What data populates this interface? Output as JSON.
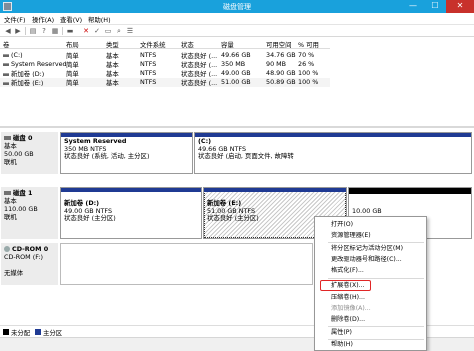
{
  "window": {
    "title": "磁盘管理",
    "min": "—",
    "max": "☐",
    "close": "✕"
  },
  "menubar": [
    "文件(F)",
    "操作(A)",
    "查看(V)",
    "帮助(H)"
  ],
  "toolbar_icons": [
    "back-icon",
    "forward-icon",
    "volume-list-icon",
    "help-icon",
    "properties-icon",
    "delete-icon",
    "cut-icon",
    "open-icon",
    "search-icon",
    "snapshot-icon"
  ],
  "volume_list": {
    "columns": [
      "卷",
      "布局",
      "类型",
      "文件系统",
      "状态",
      "容量",
      "可用空间",
      "% 可用"
    ],
    "rows": [
      {
        "name": "(C:)",
        "layout": "简单",
        "type": "基本",
        "fs": "NTFS",
        "status": "状态良好 (...",
        "capacity": "49.66 GB",
        "free": "34.76 GB",
        "pct": "70 %"
      },
      {
        "name": "System Reserved",
        "layout": "简单",
        "type": "基本",
        "fs": "NTFS",
        "status": "状态良好 (...",
        "capacity": "350 MB",
        "free": "90 MB",
        "pct": "26 %"
      },
      {
        "name": "新加卷 (D:)",
        "layout": "简单",
        "type": "基本",
        "fs": "NTFS",
        "status": "状态良好 (...",
        "capacity": "49.00 GB",
        "free": "48.90 GB",
        "pct": "100 %"
      },
      {
        "name": "新加卷 (E:)",
        "layout": "简单",
        "type": "基本",
        "fs": "NTFS",
        "status": "状态良好 (...",
        "capacity": "51.00 GB",
        "free": "50.89 GB",
        "pct": "100 %"
      }
    ]
  },
  "disks": [
    {
      "label": "磁盘 0",
      "type": "基本",
      "size": "50.00 GB",
      "state": "联机",
      "partitions": [
        {
          "name": "System Reserved",
          "detail": "350 MB NTFS",
          "status": "状态良好 (系统, 活动, 主分区)"
        },
        {
          "name": "(C:)",
          "detail": "49.66 GB NTFS",
          "status": "状态良好 (启动, 页面文件, 故障转"
        }
      ]
    },
    {
      "label": "磁盘 1",
      "type": "基本",
      "size": "110.00 GB",
      "state": "联机",
      "partitions": [
        {
          "name": "新加卷 (D:)",
          "detail": "49.00 GB NTFS",
          "status": "状态良好 (主分区)"
        },
        {
          "name": "新加卷 (E:)",
          "detail": "51.00 GB NTFS",
          "status": "状态良好 (主分区)"
        },
        {
          "name": "",
          "detail": "10.00 GB",
          "status": ""
        }
      ]
    },
    {
      "label": "CD-ROM 0",
      "type": "CD-ROM (F:)",
      "size": "",
      "state": "无媒体"
    }
  ],
  "legend": [
    {
      "label": "未分配",
      "color": "#000000"
    },
    {
      "label": "主分区",
      "color": "#1f3a93"
    }
  ],
  "context_menu": {
    "items": [
      {
        "label": "打开(O)",
        "disabled": false
      },
      {
        "label": "资源管理器(E)",
        "disabled": false
      },
      {
        "label": "将分区标记为活动分区(M)",
        "disabled": false
      },
      {
        "label": "更改驱动器号和路径(C)...",
        "disabled": false
      },
      {
        "label": "格式化(F)...",
        "disabled": false
      },
      {
        "label": "扩展卷(X)...",
        "disabled": false
      },
      {
        "label": "压缩卷(H)...",
        "disabled": false
      },
      {
        "label": "添加镜像(A)...",
        "disabled": true
      },
      {
        "label": "删除卷(D)...",
        "disabled": false
      },
      {
        "label": "属性(P)",
        "disabled": false
      },
      {
        "label": "帮助(H)",
        "disabled": false
      }
    ],
    "highlighted": "扩展卷(X)..."
  },
  "colors": {
    "titlebar": "#19a1dc",
    "primary_partition": "#1f3a93",
    "unallocated": "#000000",
    "highlight_box": "#e02626"
  }
}
